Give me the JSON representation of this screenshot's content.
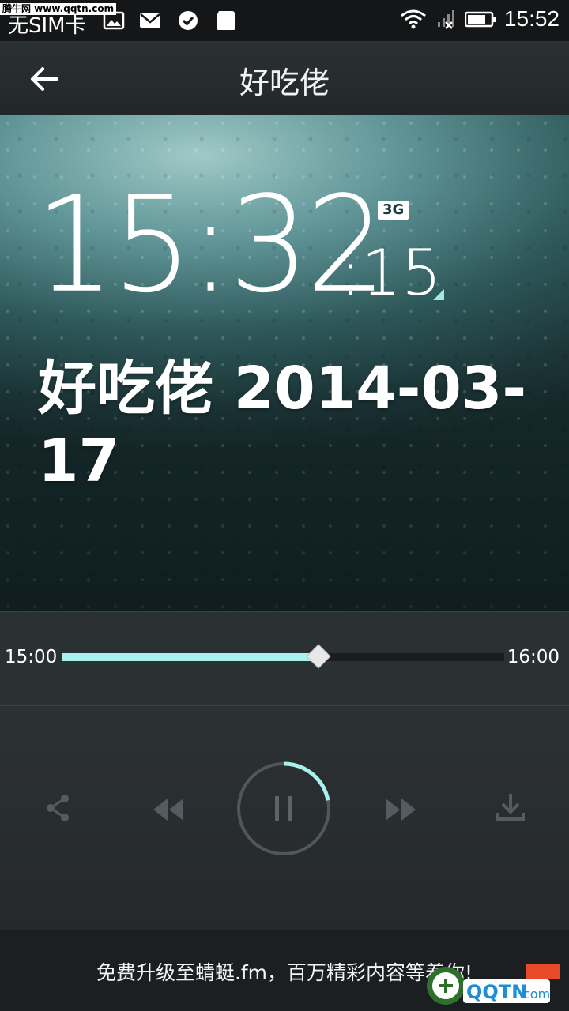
{
  "status_bar": {
    "watermark": "腾牛网 www.qqtn.com",
    "carrier": "无SIM卡",
    "time": "15:52",
    "icons": [
      "image-icon",
      "mail-icon",
      "check-circle-icon",
      "sd-card-icon",
      "wifi-icon",
      "signal-icon",
      "battery-icon"
    ]
  },
  "app_bar": {
    "back_icon": "back-arrow-icon",
    "title": "好吃佬"
  },
  "hero": {
    "time_hm": "15:32",
    "time_seconds": ":15",
    "network_badge": "3G",
    "program_title": "好吃佬 2014-03-17"
  },
  "progress": {
    "start_time": "15:00",
    "end_time": "16:00",
    "fraction": 0.58,
    "accent_color": "#a6f2ef"
  },
  "controls": {
    "icons": [
      "share-icon",
      "rewind-icon",
      "pause-icon",
      "fast-forward-icon",
      "download-icon"
    ],
    "buffer_fraction": 0.22
  },
  "footer": {
    "text": "免费升级至蜻蜓.fm，百万精彩内容等着你!",
    "watermark_logo": "QQTN.com 腾牛网"
  }
}
